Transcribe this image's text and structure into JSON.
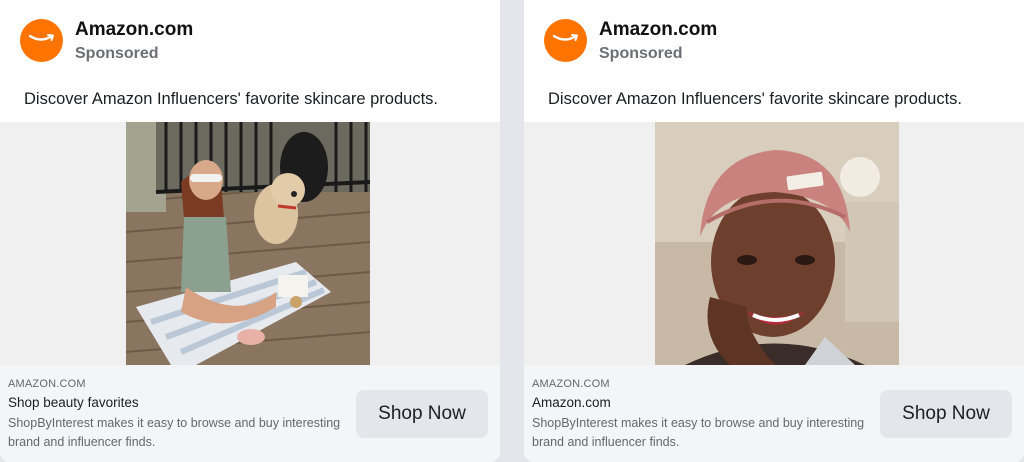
{
  "colors": {
    "brand_orange": "#ff7400",
    "cta_bg": "#e4e6eb",
    "muted_text": "#65676b"
  },
  "ads": [
    {
      "advertiser": "Amazon.com",
      "sponsored_label": "Sponsored",
      "message": "Discover Amazon Influencers' favorite skincare products.",
      "image_icon": "photo-woman-with-dog-on-deck",
      "link_domain": "AMAZON.COM",
      "headline": "Shop beauty favorites",
      "description": "ShopByInterest makes it easy to browse and buy interesting brand and influencer finds.",
      "cta_label": "Shop Now"
    },
    {
      "advertiser": "Amazon.com",
      "sponsored_label": "Sponsored",
      "message": "Discover Amazon Influencers' favorite skincare products.",
      "image_icon": "photo-smiling-woman-with-headband",
      "link_domain": "AMAZON.COM",
      "headline": "Amazon.com",
      "description": "ShopByInterest makes it easy to browse and buy interesting brand and influencer finds.",
      "cta_label": "Shop Now"
    }
  ]
}
